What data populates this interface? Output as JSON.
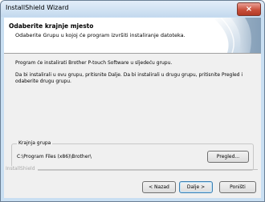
{
  "window": {
    "title": "InstallShield Wizard",
    "close_glyph": "×"
  },
  "header": {
    "title": "Odaberite krajnje mjesto",
    "subtitle": "Odaberite Grupu u kojoj će program izvršiti instaliranje datoteka."
  },
  "body": {
    "para1": "Program će instalirati  Brother P-touch Software u sljedeću grupu.",
    "para2": "Da bi instalirali u ovu grupu, pritisnite Dalje. Da bi instalirali u drugu grupu, pritisnite Pregled i odaberite drugu grupu."
  },
  "destination": {
    "legend": "Krajnja grupa",
    "path": "C:\\Program Files (x86)\\Brother\\",
    "browse_label": "Pregled..."
  },
  "footer": {
    "brand": "InstallShield",
    "back_label": "< Nazad",
    "next_label": "Dalje >",
    "cancel_label": "Poništi"
  }
}
